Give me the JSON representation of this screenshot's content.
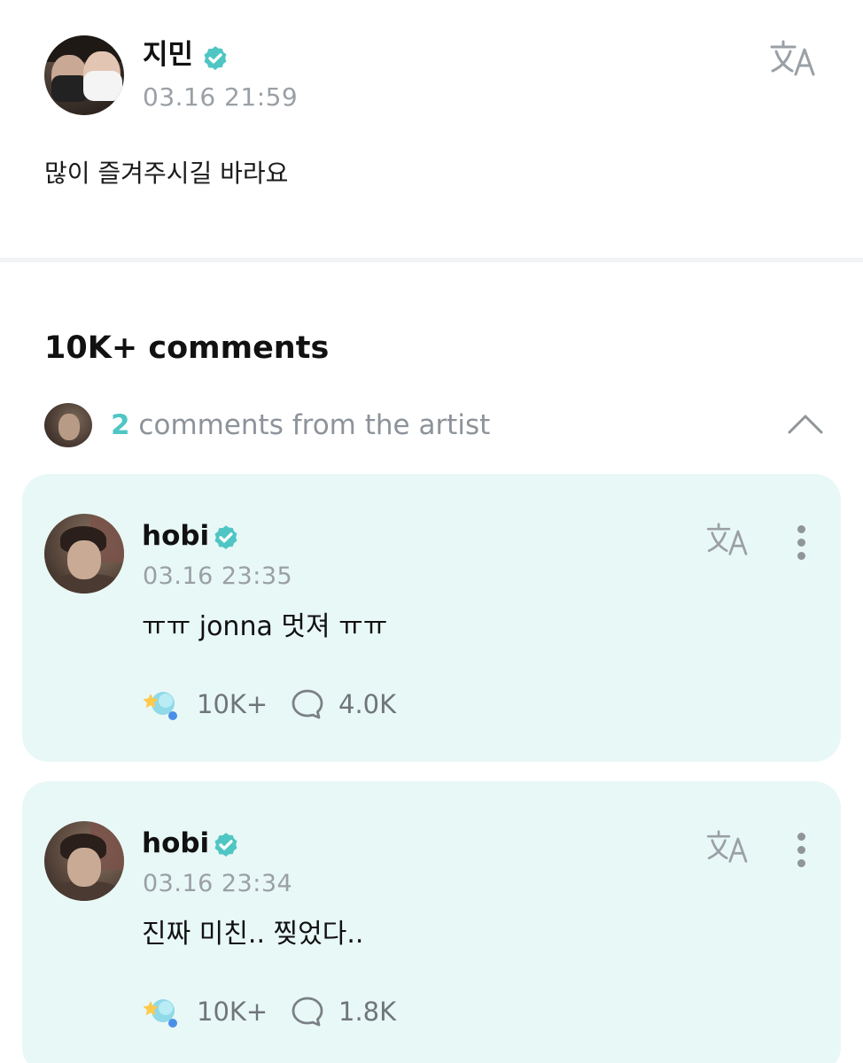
{
  "post": {
    "author": "지민",
    "timestamp": "03.16 21:59",
    "text": "많이 즐겨주시길 바라요",
    "translate_icon": "translate-icon"
  },
  "comments_section": {
    "title": "10K+ comments",
    "artist_summary": {
      "count": "2",
      "label": " comments from the artist",
      "collapse_icon": "chevron-up-icon"
    }
  },
  "comments": [
    {
      "author": "hobi",
      "timestamp": "03.16 23:35",
      "text": "ㅠㅠ jonna 멋져 ㅠㅠ",
      "likes": "10K+",
      "replies": "4.0K"
    },
    {
      "author": "hobi",
      "timestamp": "03.16 23:34",
      "text": "진짜 미친.. 찢었다..",
      "likes": "10K+",
      "replies": "1.8K"
    }
  ],
  "colors": {
    "accent": "#4fc6c4",
    "card_background": "#e8f8f6",
    "secondary_text": "#9aa0a6"
  }
}
